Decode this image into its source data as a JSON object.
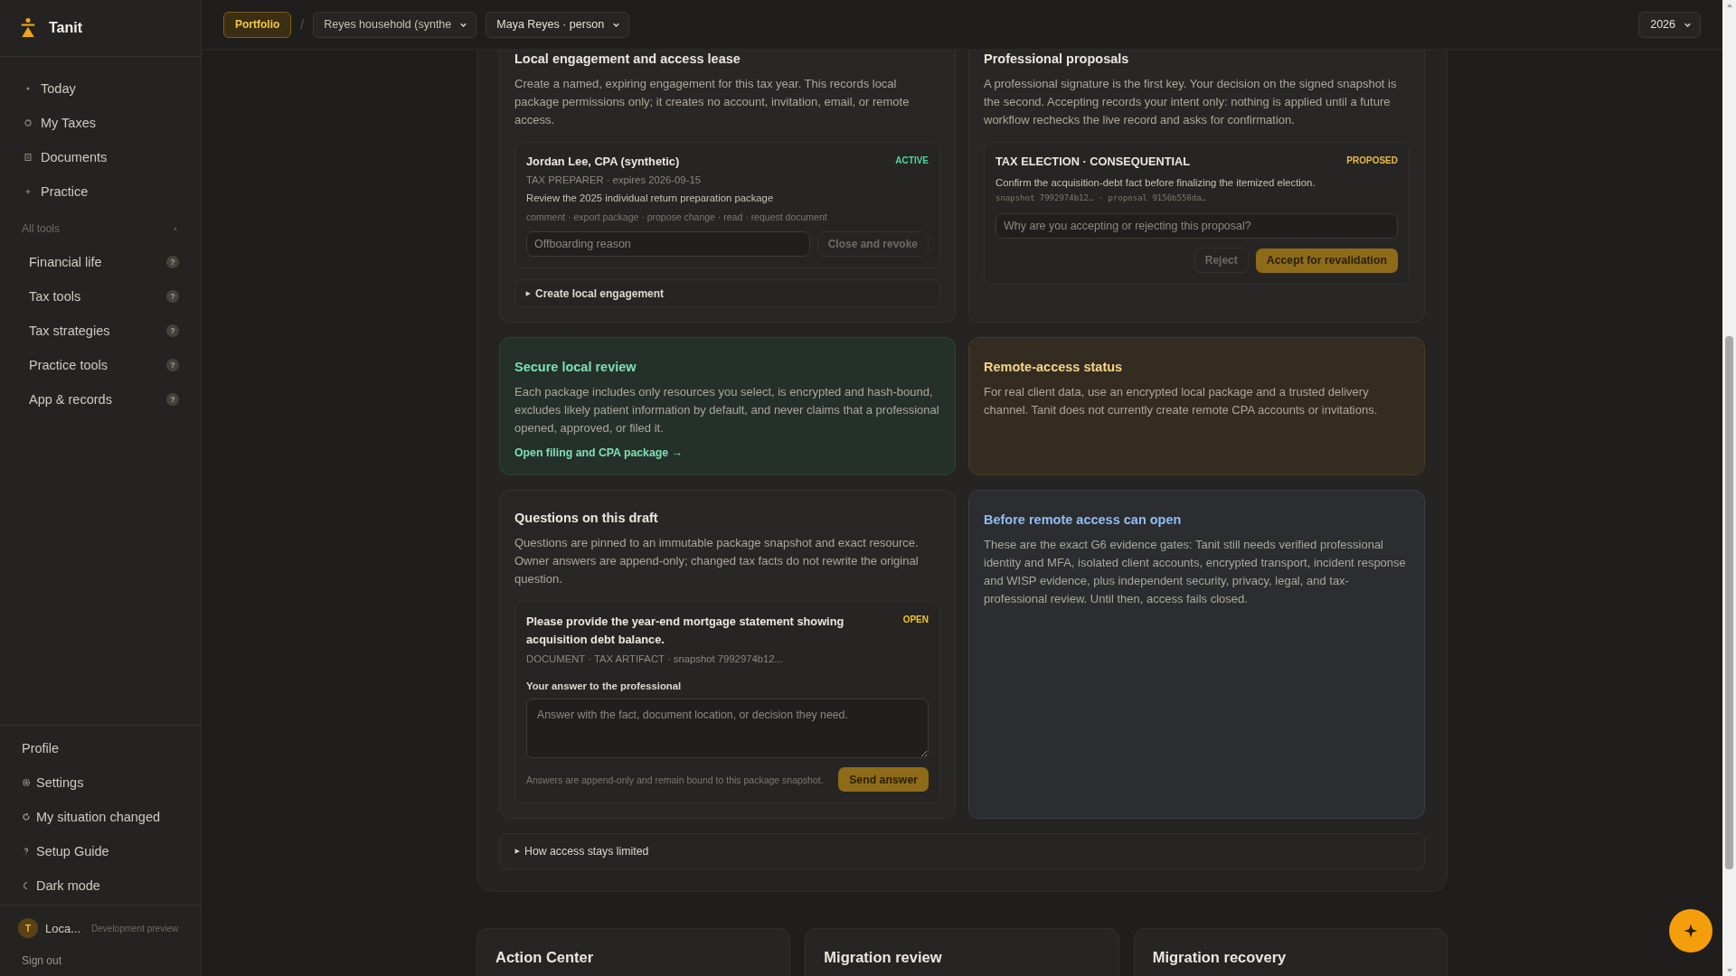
{
  "app": {
    "name": "Tanit"
  },
  "sidebar": {
    "nav": [
      {
        "label": "Today",
        "kind": "dot"
      },
      {
        "label": "My Taxes",
        "kind": "ring"
      },
      {
        "label": "Documents",
        "kind": "doc"
      },
      {
        "label": "Practice",
        "kind": "plus"
      }
    ],
    "tools_heading": "All tools",
    "tools_expanded": true,
    "tools": [
      {
        "label": "Financial life",
        "hint": "?"
      },
      {
        "label": "Tax tools",
        "hint": "?"
      },
      {
        "label": "Tax strategies",
        "hint": "?"
      },
      {
        "label": "Practice tools",
        "hint": "?"
      },
      {
        "label": "App & records",
        "hint": "?"
      }
    ],
    "footer": [
      {
        "label": "Profile",
        "kind": "plain"
      },
      {
        "label": "Settings",
        "kind": "gear"
      },
      {
        "label": "My situation changed",
        "kind": "refresh"
      },
      {
        "label": "Setup Guide",
        "kind": "question"
      },
      {
        "label": "Dark mode",
        "kind": "moon"
      }
    ],
    "user": {
      "initial": "T",
      "name": "Loca...",
      "note": "Development preview"
    },
    "sign_out": "Sign out"
  },
  "topbar": {
    "portfolio": "Portfolio",
    "separator": "/",
    "household": "Reyes household (synthe",
    "person": "Maya Reyes · person",
    "year": "2026"
  },
  "engagement": {
    "title": "Local engagement and access lease",
    "description": "Create a named, expiring engagement for this tax year. This records local package permissions only; it creates no account, invitation, email, or remote access.",
    "lease": {
      "name": "Jordan Lee, CPA (synthetic)",
      "status": "ACTIVE",
      "kind": "success",
      "role": "TAX PREPARER · expires 2026-09-15",
      "scope": "Review the 2025 individual return preparation package",
      "permissions": "comment · export package · propose change · read · request document",
      "reason_placeholder": "Offboarding reason",
      "revoke_button": "Close and revoke"
    },
    "create": {
      "label": "Create local engagement",
      "expanded": false
    }
  },
  "proposals": {
    "title": "Professional proposals",
    "description": "A professional signature is the first key. Your decision on the signed snapshot is the second. Accepting records your intent only: nothing is applied until a future workflow rechecks the live record and asks for confirmation.",
    "proposal": {
      "category": "TAX ELECTION · CONSEQUENTIAL",
      "status": "PROPOSED",
      "kind": "warning",
      "text": "Confirm the acquisition-debt fact before finalizing the itemized election.",
      "ids": "snapshot 7992974b12… · proposal 9156b558da…",
      "reason_placeholder": "Why are you accepting or rejecting this proposal?",
      "reject_button": "Reject",
      "accept_button": "Accept for revalidation"
    }
  },
  "secure_review": {
    "kind": "success",
    "title": "Secure local review",
    "text": "Each package includes only resources you select, is encrypted and hash-bound, excludes likely patient information by default, and never claims that a professional opened, approved, or filed it.",
    "link": "Open filing and CPA package →"
  },
  "remote_status": {
    "kind": "warning",
    "title": "Remote-access status",
    "text": "For real client data, use an encrypted local package and a trusted delivery channel. Tanit does not currently create remote CPA accounts or invitations."
  },
  "questions": {
    "title": "Questions on this draft",
    "description": "Questions are pinned to an immutable package snapshot and exact resource. Owner answers are append-only; changed tax facts do not rewrite the original question.",
    "question": {
      "text": "Please provide the year-end mortgage statement showing acquisition debt balance.",
      "status": "OPEN",
      "kind": "open",
      "meta": "DOCUMENT · TAX ARTIFACT · snapshot 7992974b12...",
      "answer_label": "Your answer to the professional",
      "answer_placeholder": "Answer with the fact, document location, or decision they need.",
      "footnote": "Answers are append-only and remain bound to this package snapshot.",
      "send_button": "Send answer"
    }
  },
  "gates": {
    "kind": "info",
    "title": "Before remote access can open",
    "text": "These are the exact G6 evidence gates: Tanit still needs verified professional identity and MFA, isolated client accounts, encrypted transport, incident response and WISP evidence, plus independent security, privacy, legal, and tax-professional review. Until then, access fails closed."
  },
  "limits": {
    "label": "How access stays limited",
    "expanded": false
  },
  "bottom_cards": [
    {
      "title": "Action Center"
    },
    {
      "title": "Migration review"
    },
    {
      "title": "Migration recovery"
    }
  ]
}
